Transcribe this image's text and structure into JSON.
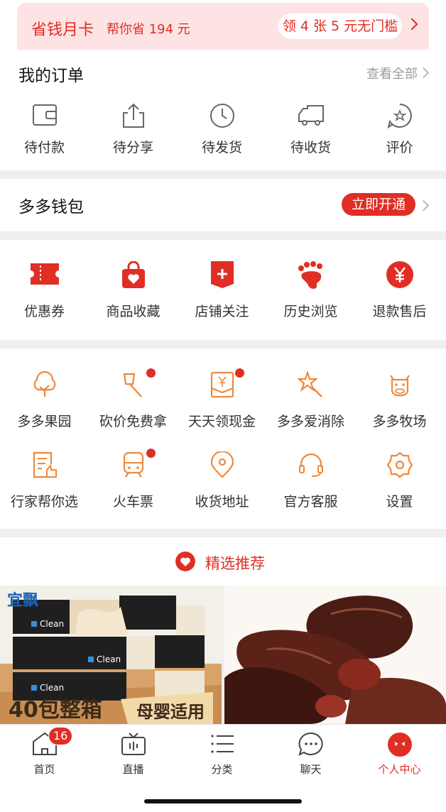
{
  "banner": {
    "title": "省钱月卡",
    "subtitle": "帮你省 194 元",
    "cta": "领 4 张 5 元无门槛"
  },
  "orders": {
    "title": "我的订单",
    "view_all": "查看全部",
    "items": [
      {
        "label": "待付款",
        "icon": "wallet-icon"
      },
      {
        "label": "待分享",
        "icon": "share-icon"
      },
      {
        "label": "待发货",
        "icon": "clock-icon"
      },
      {
        "label": "待收货",
        "icon": "truck-icon"
      },
      {
        "label": "评价",
        "icon": "review-star-icon"
      }
    ]
  },
  "wallet": {
    "title": "多多钱包",
    "button": "立即开通"
  },
  "quick": {
    "items": [
      {
        "label": "优惠券",
        "icon": "coupon-icon"
      },
      {
        "label": "商品收藏",
        "icon": "favorites-bag-icon"
      },
      {
        "label": "店铺关注",
        "icon": "store-follow-icon"
      },
      {
        "label": "历史浏览",
        "icon": "footprint-icon"
      },
      {
        "label": "退款售后",
        "icon": "refund-yen-icon"
      }
    ]
  },
  "tools": {
    "row1": [
      {
        "label": "多多果园",
        "icon": "tree-icon",
        "dot": false
      },
      {
        "label": "砍价免费拿",
        "icon": "axe-icon",
        "dot": true
      },
      {
        "label": "天天领现金",
        "icon": "cash-envelope-icon",
        "dot": true
      },
      {
        "label": "多多爱消除",
        "icon": "star-wand-icon",
        "dot": false
      },
      {
        "label": "多多牧场",
        "icon": "cow-icon",
        "dot": false
      }
    ],
    "row2": [
      {
        "label": "行家帮你选",
        "icon": "expert-picks-icon",
        "dot": false
      },
      {
        "label": "火车票",
        "icon": "train-icon",
        "dot": true
      },
      {
        "label": "收货地址",
        "icon": "location-pin-icon",
        "dot": false
      },
      {
        "label": "官方客服",
        "icon": "headset-icon",
        "dot": false
      },
      {
        "label": "设置",
        "icon": "settings-gear-icon",
        "dot": false
      }
    ]
  },
  "recommend": {
    "title": "精选推荐"
  },
  "products": {
    "p1_brand": "宜飘",
    "p1_pack_brand": "Clean",
    "p1_banner": "40包整箱",
    "p1_tag": "母婴适用"
  },
  "tabbar": {
    "items": [
      {
        "label": "首页",
        "icon": "home-icon",
        "badge": "16"
      },
      {
        "label": "直播",
        "icon": "tv-live-icon"
      },
      {
        "label": "分类",
        "icon": "category-list-icon"
      },
      {
        "label": "聊天",
        "icon": "chat-bubble-icon"
      },
      {
        "label": "个人中心",
        "icon": "profile-face-icon",
        "active": true
      }
    ]
  },
  "colors": {
    "accent": "#e02e24",
    "orange_icon": "#f0883a",
    "gray_icon": "#666666"
  }
}
